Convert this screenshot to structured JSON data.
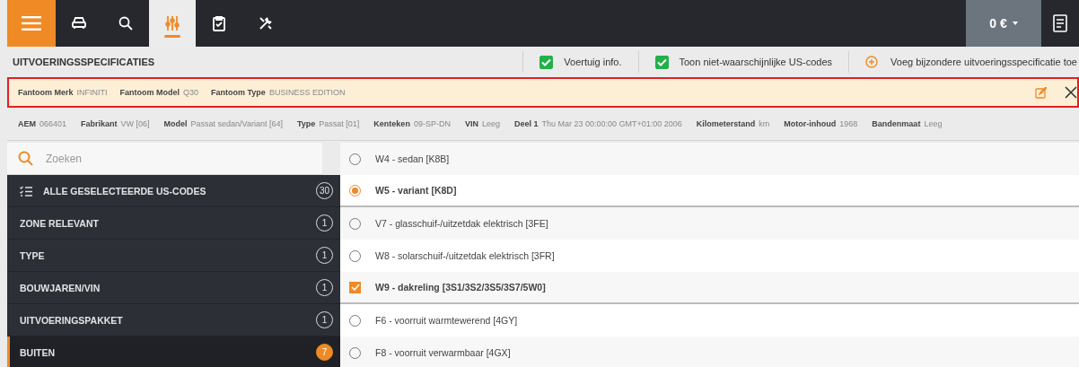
{
  "nav": {
    "tabs": [
      {
        "kind": "car",
        "selected": false
      },
      {
        "kind": "search",
        "selected": false
      },
      {
        "kind": "sliders",
        "selected": true
      },
      {
        "kind": "clipboard",
        "selected": false
      },
      {
        "kind": "tools",
        "selected": false
      }
    ],
    "price": "0 €"
  },
  "header": {
    "title": "UITVOERINGSSPECIFICATIES",
    "toggles": [
      {
        "label": "Voertuig info.",
        "checked": true
      },
      {
        "label": "Toon niet-waarschijnlijke US-codes",
        "checked": true
      }
    ],
    "add_label": "Voeg bijzondere uitvoeringsspecificatie toe"
  },
  "phantom": [
    {
      "label": "Fantoom Merk",
      "value": "INFINITI"
    },
    {
      "label": "Fantoom Model",
      "value": "Q30"
    },
    {
      "label": "Fantoom Type",
      "value": "BUSINESS EDITION"
    }
  ],
  "info": [
    {
      "label": "AEM",
      "value": "066401"
    },
    {
      "label": "Fabrikant",
      "value": "VW [06]"
    },
    {
      "label": "Model",
      "value": "Passat sedan/Variant [64]"
    },
    {
      "label": "Type",
      "value": "Passat [01]"
    },
    {
      "label": "Kenteken",
      "value": "09-SP-DN"
    },
    {
      "label": "VIN",
      "value": "Leeg"
    },
    {
      "label": "Deel 1",
      "value": "Thu Mar 23 00:00:00 GMT+01:00 2006"
    },
    {
      "label": "Kilometerstand",
      "value": "km"
    },
    {
      "label": "Motor-inhoud",
      "value": "1968"
    },
    {
      "label": "Bandenmaat",
      "value": "Leeg"
    }
  ],
  "search": {
    "placeholder": "Zoeken"
  },
  "sidebar": {
    "items": [
      {
        "label": "ALLE GESELECTEERDE US-CODES",
        "count": "30",
        "kind": "all",
        "selected": false
      },
      {
        "label": "ZONE RELEVANT",
        "count": "1",
        "kind": "category",
        "selected": false
      },
      {
        "label": "TYPE",
        "count": "1",
        "kind": "category",
        "selected": false
      },
      {
        "label": "BOUWJAREN/VIN",
        "count": "1",
        "kind": "category",
        "selected": false
      },
      {
        "label": "UITVOERINGSPAKKET",
        "count": "1",
        "kind": "category",
        "selected": false
      },
      {
        "label": "BUITEN",
        "count": "7",
        "kind": "category",
        "selected": true
      }
    ]
  },
  "options": [
    {
      "label": "W4 - sedan [K8B]",
      "kind": "radio",
      "selected": false
    },
    {
      "label": "W5 - variant [K8D]",
      "kind": "radio",
      "selected": true
    },
    {
      "label": "V7 - glasschuif-/uitzetdak elektrisch [3FE]",
      "kind": "radio",
      "selected": false
    },
    {
      "label": "W8 - solarschuif-/uitzetdak elektrisch [3FR]",
      "kind": "radio",
      "selected": false
    },
    {
      "label": "W9 - dakreling [3S1/3S2/3S5/3S7/5W0]",
      "kind": "checkbox",
      "selected": true
    },
    {
      "label": "F6 - voorruit warmtewerend [4GY]",
      "kind": "radio",
      "selected": false
    },
    {
      "label": "F8 - voorruit verwarmbaar [4GX]",
      "kind": "radio",
      "selected": false
    }
  ]
}
